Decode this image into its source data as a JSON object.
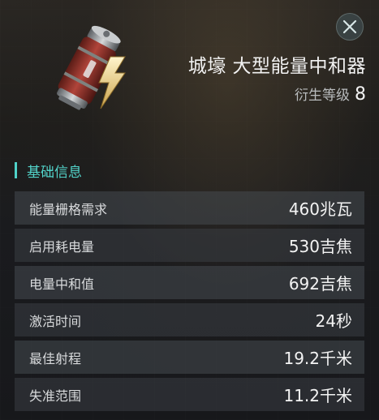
{
  "header": {
    "title": "城壕 大型能量中和器",
    "meta_label": "衍生等级",
    "meta_value": "8"
  },
  "icons": {
    "item": "capacitor-battery-lightning-icon",
    "close": "close-x-icon"
  },
  "section": {
    "title": "基础信息"
  },
  "stats": [
    {
      "label": "能量栅格需求",
      "value": "460兆瓦"
    },
    {
      "label": "启用耗电量",
      "value": "530吉焦"
    },
    {
      "label": "电量中和值",
      "value": "692吉焦"
    },
    {
      "label": "激活时间",
      "value": "24秒"
    },
    {
      "label": "最佳射程",
      "value": "19.2千米"
    },
    {
      "label": "失准范围",
      "value": "11.2千米"
    }
  ],
  "colors": {
    "accent": "#4fd2c9",
    "text": "#f2f2f2"
  }
}
